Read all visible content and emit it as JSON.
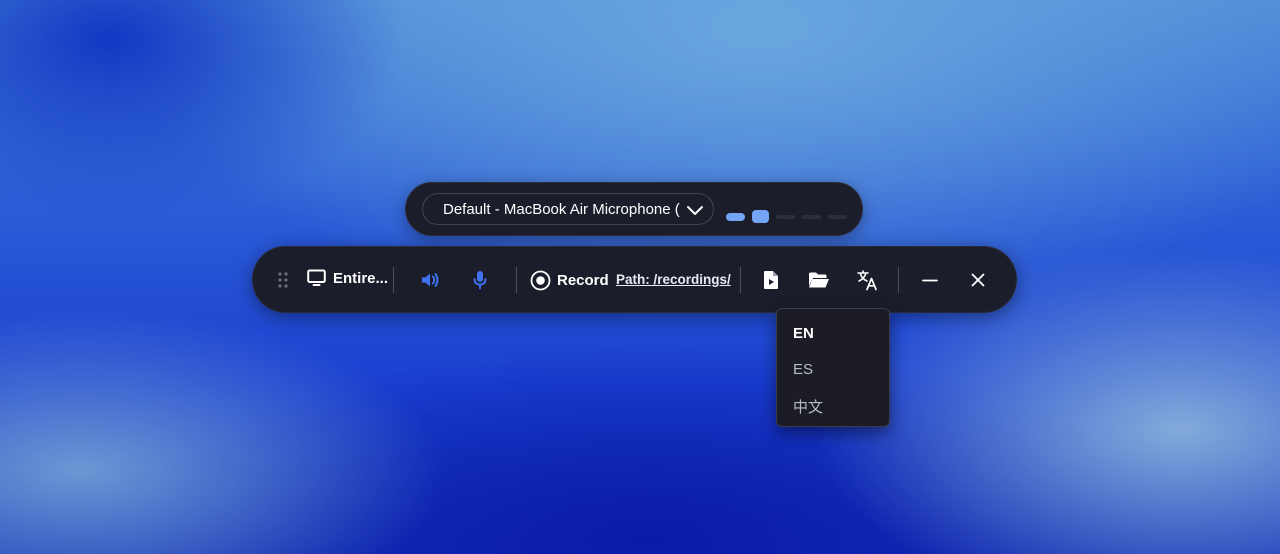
{
  "mic_bar": {
    "selected_device": "Default - MacBook Air Microphone (",
    "level_meter": {
      "segments": 5,
      "active": 2
    }
  },
  "toolbar": {
    "source_label": "Entire...",
    "record_label": "Record",
    "path_label": "Path: /recordings/"
  },
  "language_menu": {
    "items": [
      {
        "label": "EN",
        "selected": true
      },
      {
        "label": "ES",
        "selected": false
      },
      {
        "label": "中文",
        "selected": false
      }
    ]
  },
  "colors": {
    "panel_bg": "#1b1d2a",
    "accent_blue": "#3f72f2",
    "level_active": "#74a4f5"
  }
}
